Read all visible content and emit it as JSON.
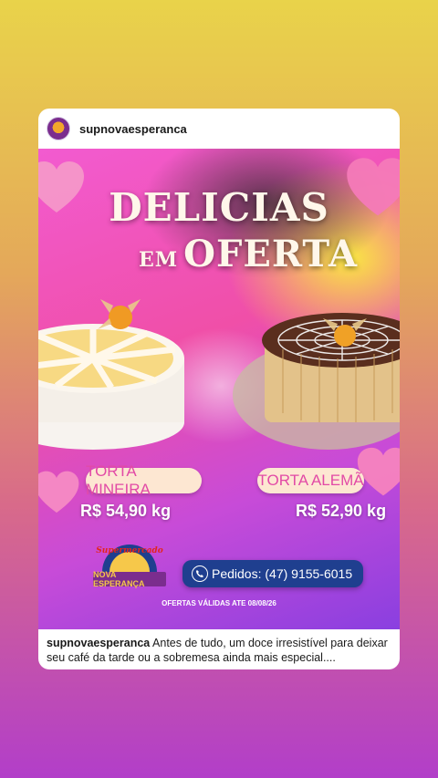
{
  "post": {
    "username": "supnovaesperanca",
    "title_line1": "DELICIAS",
    "title_line2_small": "EM",
    "title_line2_big": "OFERTA",
    "products": [
      {
        "name": "TORTA MINEIRA",
        "price": "R$ 54,90 kg"
      },
      {
        "name": "TORTA ALEMÃ",
        "price": "R$ 52,90 kg"
      }
    ],
    "logo": {
      "line1": "Supermercado",
      "line2": "NOVA ESPERANÇA"
    },
    "phone_label": "Pedidos: (47) 9155-6015",
    "validity": "OFERTAS VÁLIDAS ATE 08/08/26",
    "caption_user": "supnovaesperanca",
    "caption_text": "Antes de tudo, um doce irresistível para deixar seu café da tarde ou a sobremesa ainda mais especial...."
  },
  "colors": {
    "pill_bg": "#fde7d2",
    "pill_text": "#e24aa6",
    "phone_bg": "#1f3f8f",
    "logo_purple": "#7b2d8e",
    "logo_yellow": "#f6c84a"
  }
}
